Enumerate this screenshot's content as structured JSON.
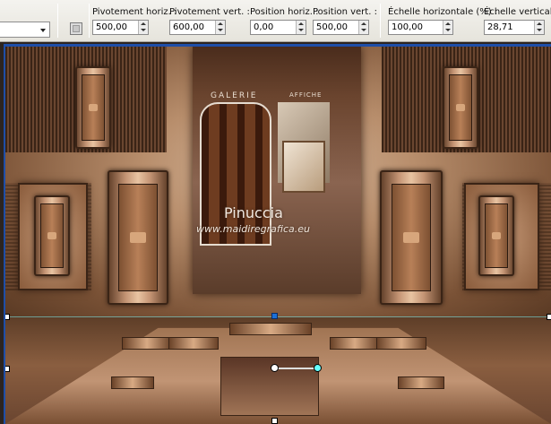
{
  "toolbar": {
    "fields": [
      {
        "label": "Pivotement horiz. :",
        "value": "500,00"
      },
      {
        "label": "Pivotement vert. :",
        "value": "600,00"
      },
      {
        "label": "Position horiz. :",
        "value": "0,00"
      },
      {
        "label": "Position vert. :",
        "value": "500,00"
      },
      {
        "label": "Échelle horizontale (%) :",
        "value": "100,00"
      },
      {
        "label": "Échelle verticale (",
        "value": "28,71"
      }
    ]
  },
  "canvas": {
    "photo": {
      "galerie": "GALERIE",
      "affiche": "AFFICHE"
    },
    "signature": {
      "name": "Pinuccia",
      "url": "www.maidiregrafica.eu"
    }
  }
}
